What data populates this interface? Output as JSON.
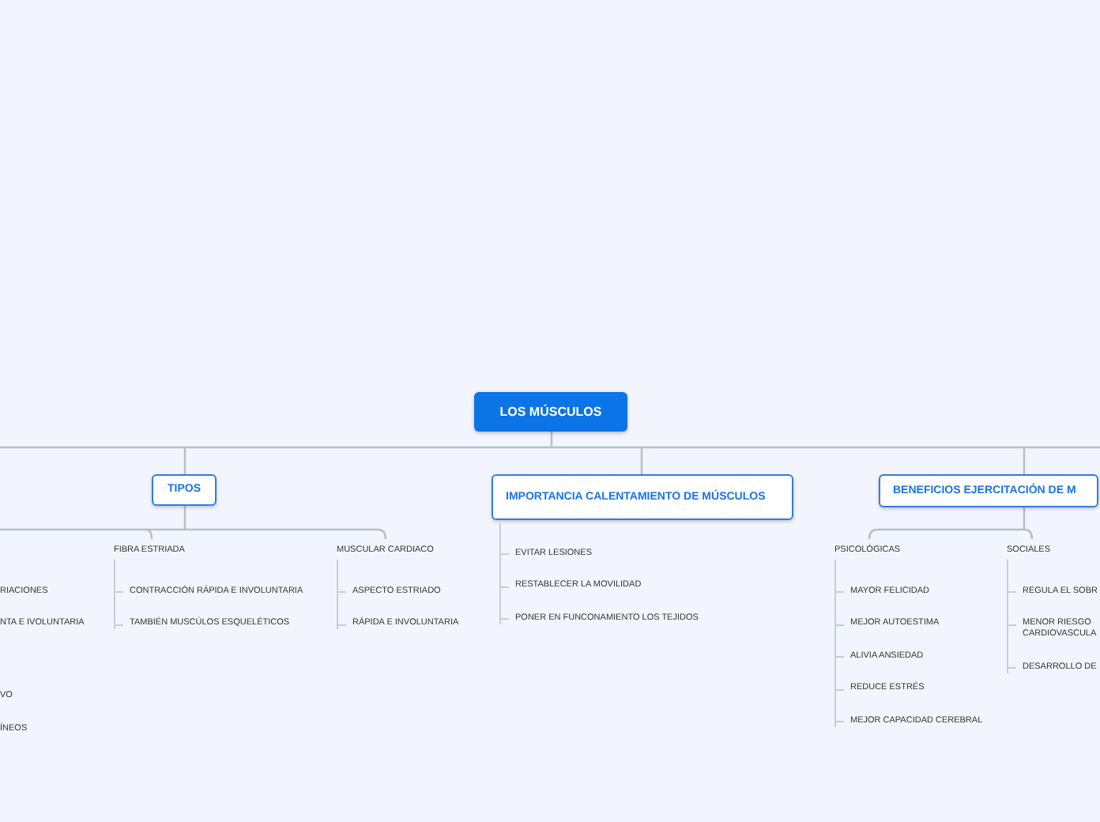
{
  "root": {
    "title": "LOS MÚSCULOS"
  },
  "branches": [
    {
      "title": "TIPOS",
      "children": [
        {
          "label": "FIBRA ESTRIADA",
          "children": [
            "CONTRACCIÓN RÁPIDA E INVOLUNTARIA",
            "TAMBIÉN MUSCÚLOS ESQUELÉTICOS"
          ]
        },
        {
          "label": "MUSCULAR CARDIACO",
          "children": [
            "ASPECTO ESTRIADO",
            "RÁPIDA E INVOLUNTARIA"
          ]
        }
      ]
    },
    {
      "title": "IMPORTANCIA CALENTAMIENTO DE MÚSCULOS",
      "leaves": [
        "EVITAR LESIONES",
        "RESTABLECER LA MOVILIDAD",
        "PONER EN FUNCONAMIENTO LOS TEJIDOS"
      ]
    },
    {
      "title": "BENEFICIOS EJERCITACIÓN DE M",
      "children": [
        {
          "label": "PSICOLÓGICAS",
          "children": [
            "MAYOR FELICIDAD",
            "MEJOR AUTOESTIMA",
            "ALIVIA ANSIEDAD",
            "REDUCE ESTRÉS",
            "MEJOR CAPACIDAD CEREBRAL"
          ]
        },
        {
          "label": "SOCIALES",
          "children": [
            "REGULA EL SOBR",
            "MENOR RIESGO CARDIOVASCULA",
            "DESARROLLO DE"
          ]
        }
      ]
    }
  ],
  "left_fragments": [
    "RIACIONES",
    "NTA E IVOLUNTARIA",
    "VO",
    "ÍNEOS"
  ]
}
